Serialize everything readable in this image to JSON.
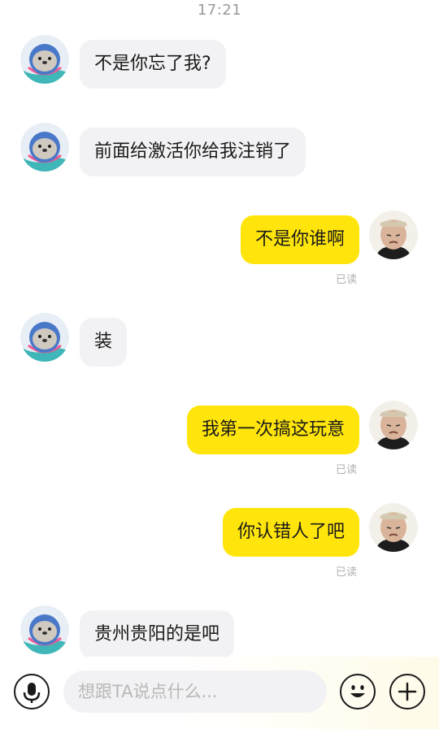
{
  "status": {
    "time": "17:21"
  },
  "messages": [
    {
      "side": "in",
      "text": "不是你忘了我?",
      "read": ""
    },
    {
      "side": "in",
      "text": "前面给激活你给我注销了",
      "read": ""
    },
    {
      "side": "out",
      "text": "不是你谁啊",
      "read": "已读"
    },
    {
      "side": "in",
      "text": "装",
      "read": ""
    },
    {
      "side": "out",
      "text": "我第一次搞这玩意",
      "read": "已读"
    },
    {
      "side": "out",
      "text": "你认错人了吧",
      "read": "已读"
    },
    {
      "side": "in",
      "text": "贵州贵阳的是吧",
      "read": ""
    }
  ],
  "input": {
    "placeholder": "想跟TA说点什么..."
  },
  "icons": {
    "voice": "microphone-icon",
    "emoji": "smiley-icon",
    "plus": "plus-icon",
    "other_avatar": "seal-avatar-icon",
    "my_avatar": "user-photo-avatar"
  },
  "colors": {
    "out_bubble": "#ffe50c",
    "in_bubble": "#f2f2f4",
    "read_text": "#b0b0b0"
  }
}
